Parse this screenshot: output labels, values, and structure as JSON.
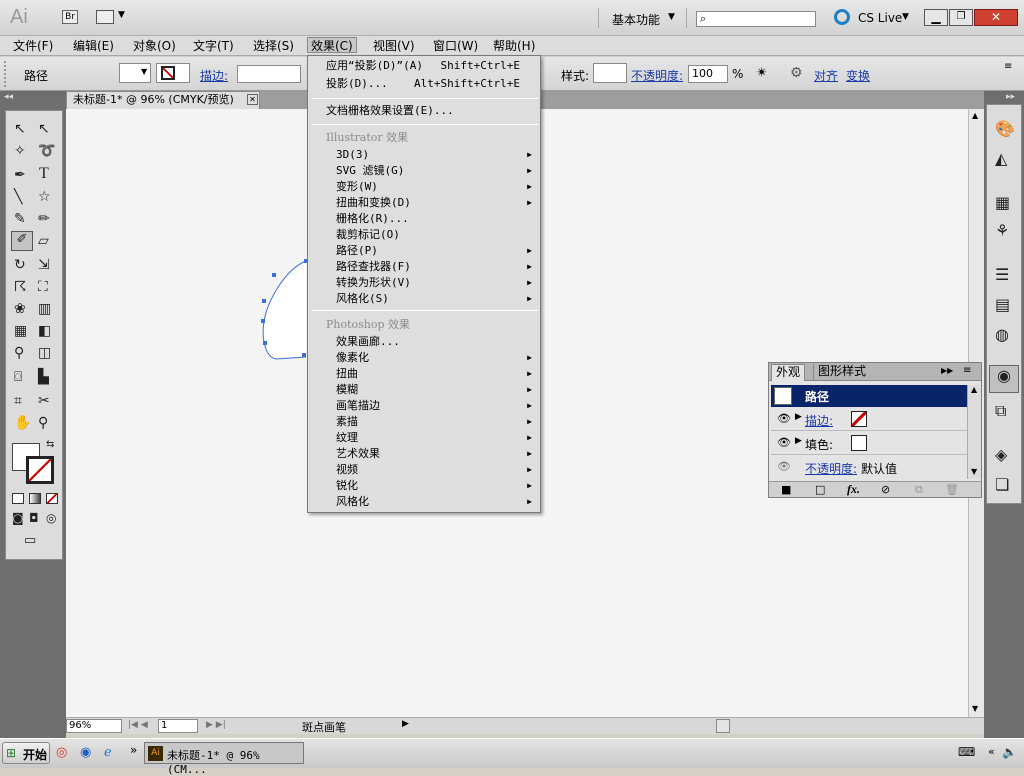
{
  "app": {
    "logo": "Ai",
    "bridge": "Br",
    "workspace": "基本功能",
    "cslive": "CS Live"
  },
  "menubar": [
    "文件(F)",
    "编辑(E)",
    "对象(O)",
    "文字(T)",
    "选择(S)",
    "效果(C)",
    "视图(V)",
    "窗口(W)",
    "帮助(H)"
  ],
  "control": {
    "label": "路径",
    "stroke": "描边:",
    "style": "样式:",
    "opacity": "不透明度:",
    "opacity_value": "100",
    "percent": "%",
    "align": "对齐",
    "transform": "变换"
  },
  "document": {
    "tab": "未标题-1* @ 96% (CMYK/预览)",
    "zoom": "96%",
    "artboard": "1",
    "status": "斑点画笔"
  },
  "effect_menu": {
    "apply_last": "应用“投影(D)”(A)",
    "apply_last_shortcut": "Shift+Ctrl+E",
    "last": "投影(D)...",
    "last_shortcut": "Alt+Shift+Ctrl+E",
    "raster_settings": "文档栅格效果设置(E)...",
    "illustrator_header": "Illustrator 效果",
    "illustrator_items": [
      {
        "label": "3D(3)",
        "sub": true
      },
      {
        "label": "SVG 滤镜(G)",
        "sub": true
      },
      {
        "label": "变形(W)",
        "sub": true
      },
      {
        "label": "扭曲和变换(D)",
        "sub": true
      },
      {
        "label": "栅格化(R)...",
        "sub": false
      },
      {
        "label": "裁剪标记(O)",
        "sub": false
      },
      {
        "label": "路径(P)",
        "sub": true
      },
      {
        "label": "路径查找器(F)",
        "sub": true
      },
      {
        "label": "转换为形状(V)",
        "sub": true
      },
      {
        "label": "风格化(S)",
        "sub": true
      }
    ],
    "photoshop_header": "Photoshop 效果",
    "photoshop_items": [
      {
        "label": "效果画廊...",
        "sub": false
      },
      {
        "label": "像素化",
        "sub": true
      },
      {
        "label": "扭曲",
        "sub": true
      },
      {
        "label": "模糊",
        "sub": true
      },
      {
        "label": "画笔描边",
        "sub": true
      },
      {
        "label": "素描",
        "sub": true
      },
      {
        "label": "纹理",
        "sub": true
      },
      {
        "label": "艺术效果",
        "sub": true
      },
      {
        "label": "视频",
        "sub": true
      },
      {
        "label": "锐化",
        "sub": true
      },
      {
        "label": "风格化",
        "sub": true
      }
    ]
  },
  "appearance": {
    "tab1": "外观",
    "tab2": "图形样式",
    "path": "路径",
    "stroke": "描边:",
    "fill": "填色:",
    "opacity": "不透明度:",
    "opacity_value": "默认值"
  },
  "taskbar": {
    "start": "开始",
    "task": "未标题-1* @ 96% (CM..."
  }
}
